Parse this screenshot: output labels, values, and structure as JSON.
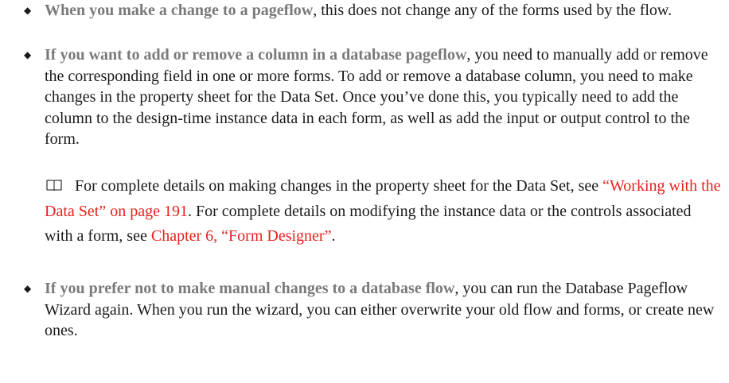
{
  "items": [
    {
      "lead": "When you make a change to a pageflow",
      "text": ", this does not change any of the forms used by the flow."
    },
    {
      "lead": "If you want to add or remove a column in a database pageflow",
      "text": ", you need to manually add or remove the corresponding field in one or more forms. To add or remove a database column, you need to make changes in the property sheet for the Data Set. Once you’ve done this, you typically need to add the column to the design-time instance data in each form, as well as add the input or output control to the form."
    },
    {
      "lead": "If you prefer not to make manual changes to a database flow",
      "text": ", you can run the Database Pageflow Wizard again. When you run the wizard, you can either overwrite your old flow and forms, or create new ones."
    }
  ],
  "note": {
    "icon": "book-icon",
    "text1": "For complete details on making changes in the property sheet for the Data Set, see ",
    "link1": "“Working with the Data Set” on page 191",
    "text2": ". For complete details on modifying the instance data or the controls associated with a form, see ",
    "link2": "Chapter 6, “Form Designer”",
    "text3": "."
  },
  "colors": {
    "lead": "#7a7a7a",
    "link": "#e8211c",
    "text": "#1a1a1a"
  }
}
